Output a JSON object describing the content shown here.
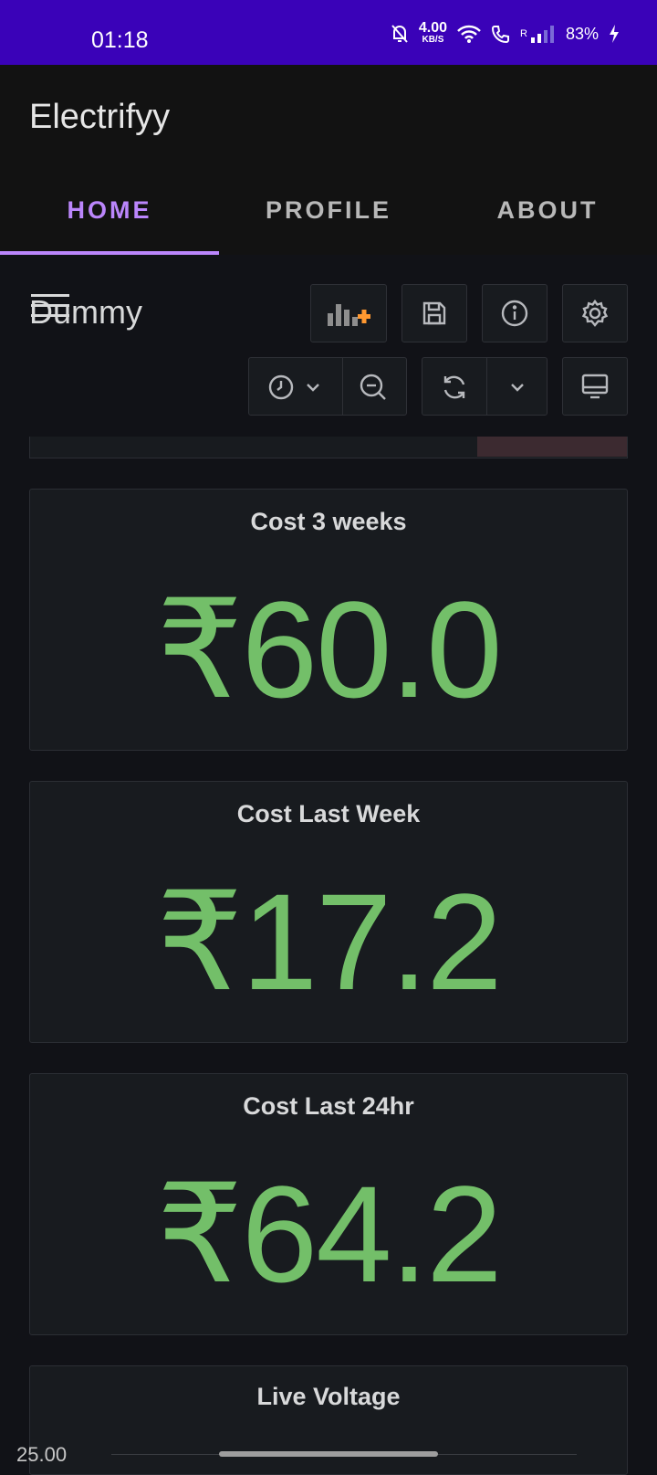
{
  "status_bar": {
    "time": "01:18",
    "net_speed_value": "4.00",
    "net_speed_unit": "KB/S",
    "signal_tag": "R",
    "battery": "83%"
  },
  "app": {
    "title": "Electrifyy"
  },
  "tabs": [
    {
      "label": "HOME",
      "active": true
    },
    {
      "label": "PROFILE",
      "active": false
    },
    {
      "label": "ABOUT",
      "active": false
    }
  ],
  "dashboard": {
    "title": "Dummy"
  },
  "panels": [
    {
      "title": "Cost 3 weeks",
      "value": "₹60.0"
    },
    {
      "title": "Cost Last Week",
      "value": "₹17.2"
    },
    {
      "title": "Cost Last 24hr",
      "value": "₹64.2"
    }
  ],
  "live_panel": {
    "title": "Live Voltage",
    "y_tick": "25.00"
  },
  "colors": {
    "accent": "#bb86fc",
    "status_bar": "#3a02b8",
    "stat_green": "#73bf69",
    "add_panel_orange": "#ff9830"
  },
  "icons": {
    "toolbar": [
      "add-panel-icon",
      "save-icon",
      "info-icon",
      "settings-icon",
      "clock-icon",
      "zoom-out-icon",
      "refresh-icon",
      "chevron-down-icon",
      "monitor-icon"
    ]
  }
}
